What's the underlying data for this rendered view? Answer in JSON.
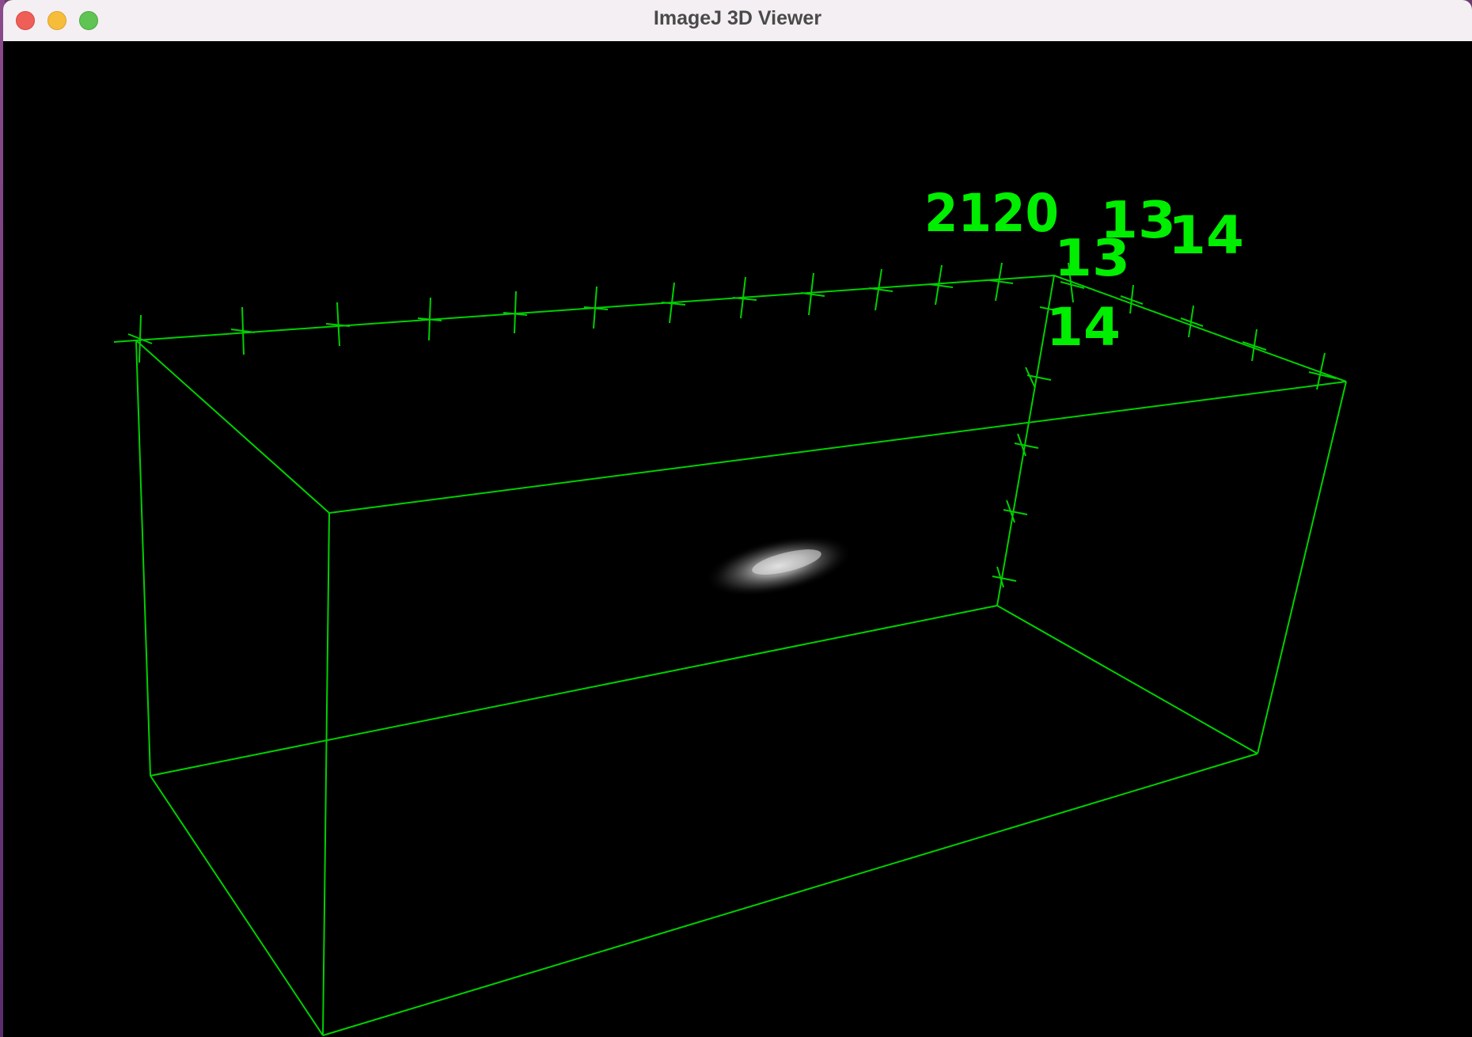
{
  "window": {
    "title": "ImageJ 3D Viewer"
  },
  "viewer": {
    "background_color": "#000000",
    "bounding_box_color": "#00d000",
    "label_color": "#00ee00",
    "axis_labels": [
      "2120",
      "13",
      "13",
      "14",
      "14"
    ]
  },
  "icons": {
    "close": "close-icon",
    "minimize": "minimize-icon",
    "maximize": "maximize-icon"
  }
}
